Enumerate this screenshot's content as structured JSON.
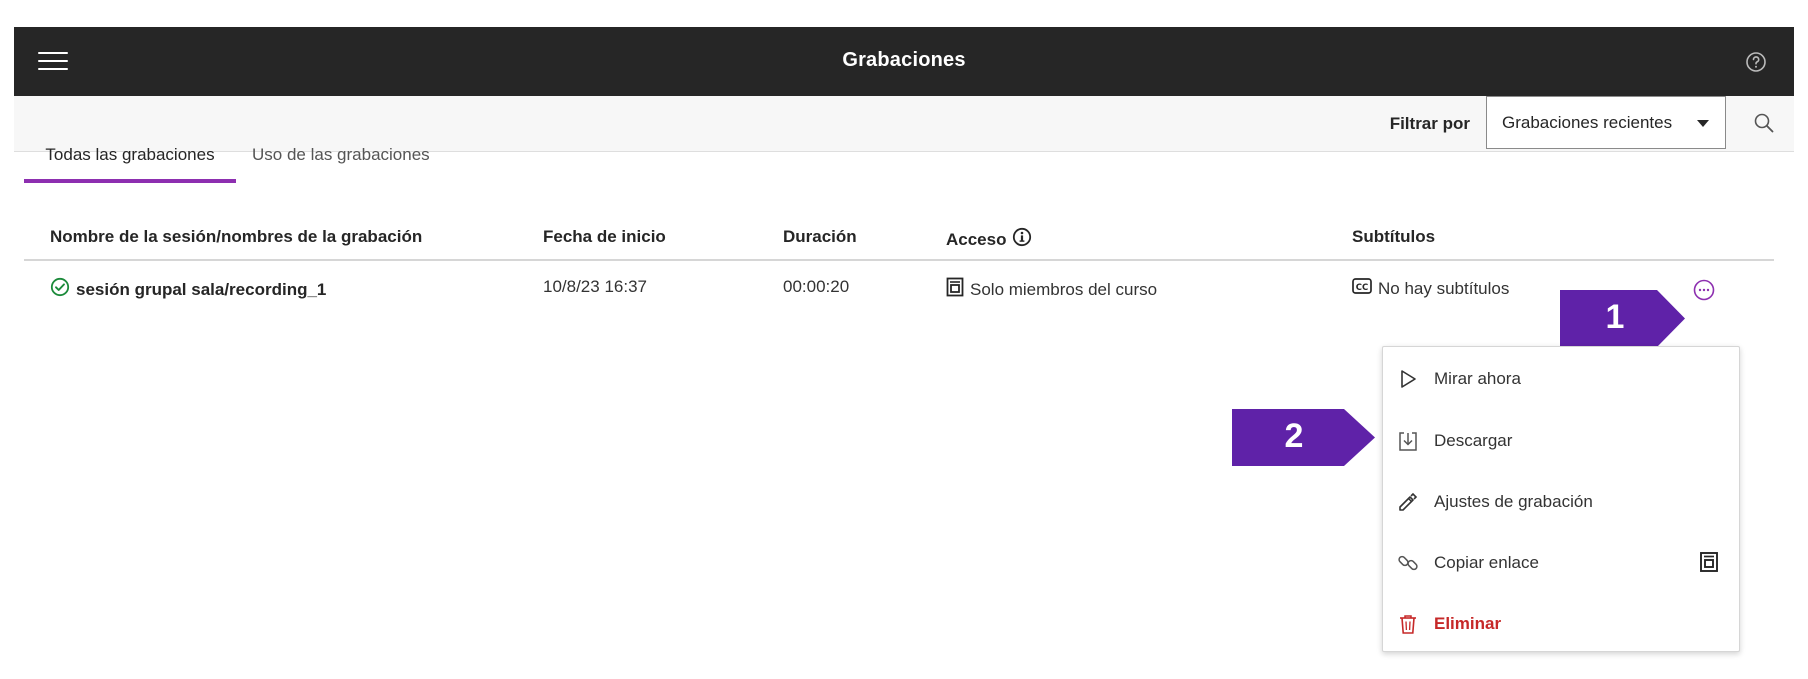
{
  "header": {
    "title": "Grabaciones",
    "menu_icon": "hamburger-menu-icon",
    "help_icon": "help-icon"
  },
  "filter": {
    "label": "Filtrar por",
    "selected": "Grabaciones recientes",
    "search_icon": "search-icon"
  },
  "tabs": [
    {
      "label": "Todas las grabaciones",
      "active": true
    },
    {
      "label": "Uso de las grabaciones",
      "active": false
    }
  ],
  "table": {
    "columns": {
      "name": "Nombre de la sesión/nombres de la grabación",
      "start": "Fecha de inicio",
      "duration": "Duración",
      "access": "Acceso",
      "subtitles": "Subtítulos"
    },
    "rows": [
      {
        "name": "sesión grupal sala/recording_1",
        "start": "10/8/23 16:37",
        "duration": "00:00:20",
        "access": "Solo miembros del curso",
        "subtitles": "No hay subtítulos"
      }
    ]
  },
  "menu": {
    "items": [
      {
        "label": "Mirar ahora",
        "icon": "play-icon"
      },
      {
        "label": "Descargar",
        "icon": "download-icon"
      },
      {
        "label": "Ajustes de grabación",
        "icon": "pencil-icon"
      },
      {
        "label": "Copiar enlace",
        "icon": "link-icon"
      },
      {
        "label": "Eliminar",
        "icon": "trash-icon"
      }
    ]
  },
  "callouts": [
    "1",
    "2"
  ],
  "colors": {
    "header_bg": "#262626",
    "accent": "#8d2fb0",
    "callout": "#5f22a8",
    "danger": "#c62828",
    "success": "#1b8a3a"
  }
}
